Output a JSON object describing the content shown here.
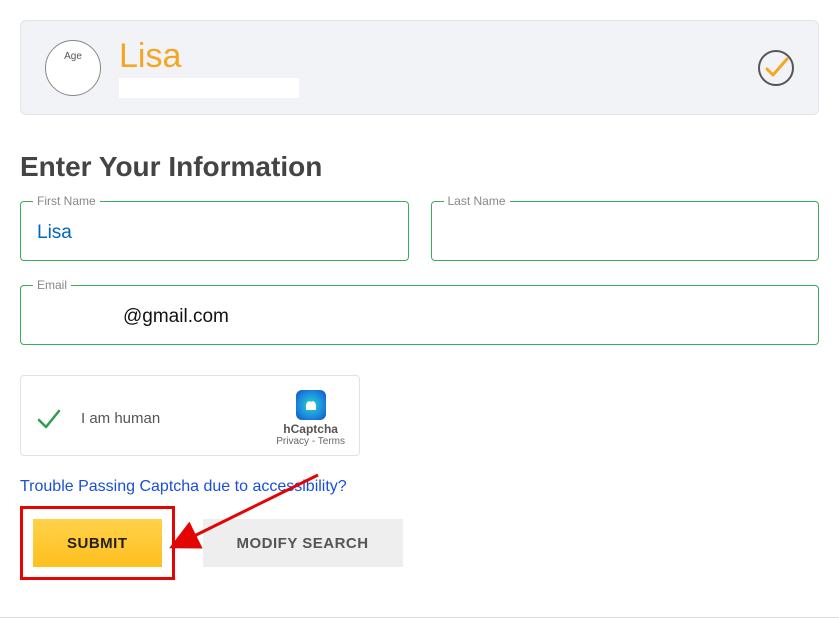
{
  "profile": {
    "age_label": "Age",
    "name": "Lisa"
  },
  "section_title": "Enter Your Information",
  "form": {
    "first_name": {
      "label": "First Name",
      "value": "Lisa"
    },
    "last_name": {
      "label": "Last Name",
      "value": ""
    },
    "email": {
      "label": "Email",
      "value": "@gmail.com"
    }
  },
  "captcha": {
    "status_text": "I am human",
    "brand": "hCaptcha",
    "privacy": "Privacy",
    "terms": "Terms"
  },
  "accessibility_link": "Trouble Passing Captcha due to accessibility?",
  "buttons": {
    "submit": "SUBMIT",
    "modify": "MODIFY SEARCH"
  }
}
